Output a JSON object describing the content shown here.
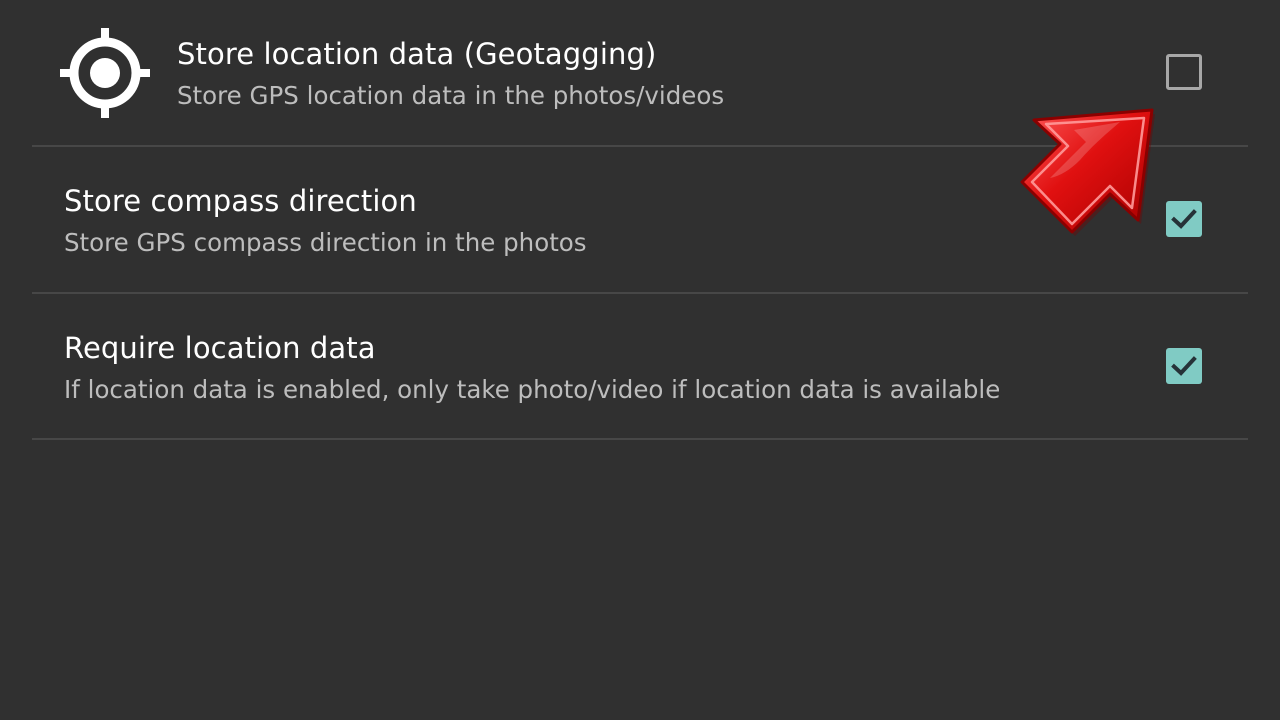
{
  "preferences": [
    {
      "title": "Store location data (Geotagging)",
      "summary": "Store GPS location data in the photos/videos",
      "checked": false,
      "icon": "gps-target-icon"
    },
    {
      "title": "Store compass direction",
      "summary": "Store GPS compass direction in the photos",
      "checked": true
    },
    {
      "title": "Require location data",
      "summary": "If location data is enabled, only take photo/video if location data is available",
      "checked": true
    }
  ],
  "colors": {
    "background": "#303030",
    "divider": "#474747",
    "title": "#ffffff",
    "summary": "#bdbdbd",
    "checkbox_checked": "#80cbc4",
    "checkbox_unchecked_border": "#a7a7a7",
    "checkmark": "#263238",
    "arrow": "#d40000"
  },
  "annotation": {
    "icon": "red-arrow-pointer-icon"
  }
}
